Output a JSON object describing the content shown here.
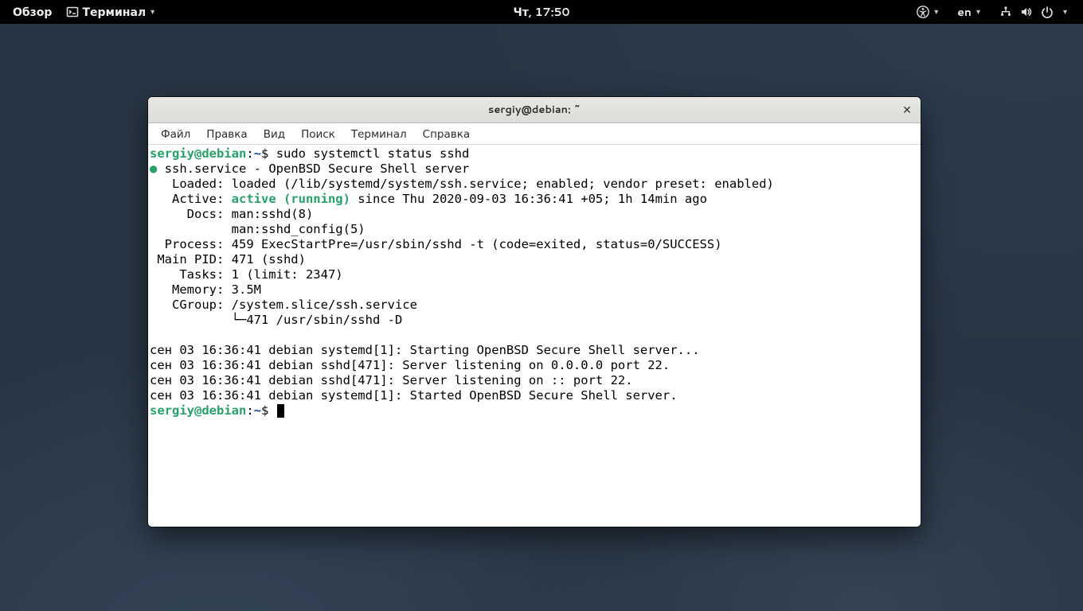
{
  "panel": {
    "activities": "Обзор",
    "app_label": "Терминал",
    "clock": "Чт, 17:50",
    "lang": "en"
  },
  "window": {
    "title": "sergiy@debian: ~",
    "menus": {
      "file": "Файл",
      "edit": "Правка",
      "view": "Вид",
      "search": "Поиск",
      "terminal": "Терминал",
      "help": "Справка"
    }
  },
  "term": {
    "prompt_user": "sergiy@debian",
    "prompt_sep": ":",
    "prompt_path": "~",
    "prompt_dollar": "$ ",
    "cmd1": "sudo systemctl status sshd",
    "l1": " ssh.service - OpenBSD Secure Shell server",
    "l2": "   Loaded: loaded (/lib/systemd/system/ssh.service; enabled; vendor preset: enabled)",
    "l3a": "   Active: ",
    "l3b": "active (running)",
    "l3c": " since Thu 2020-09-03 16:36:41 +05; 1h 14min ago",
    "l4": "     Docs: man:sshd(8)",
    "l5": "           man:sshd_config(5)",
    "l6": "  Process: 459 ExecStartPre=/usr/sbin/sshd -t (code=exited, status=0/SUCCESS)",
    "l7": " Main PID: 471 (sshd)",
    "l8": "    Tasks: 1 (limit: 2347)",
    "l9": "   Memory: 3.5M",
    "l10": "   CGroup: /system.slice/ssh.service",
    "l11": "           └─471 /usr/sbin/sshd -D",
    "log1": "сен 03 16:36:41 debian systemd[1]: Starting OpenBSD Secure Shell server...",
    "log2": "сен 03 16:36:41 debian sshd[471]: Server listening on 0.0.0.0 port 22.",
    "log3": "сен 03 16:36:41 debian sshd[471]: Server listening on :: port 22.",
    "log4": "сен 03 16:36:41 debian systemd[1]: Started OpenBSD Secure Shell server."
  }
}
